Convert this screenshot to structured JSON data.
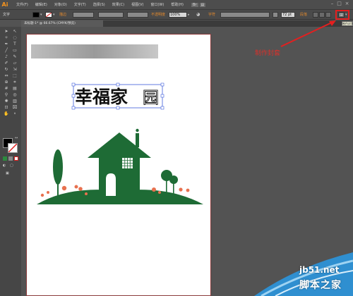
{
  "app": {
    "logo": "Ai"
  },
  "menu": [
    "文件(F)",
    "编辑(E)",
    "对象(O)",
    "文字(T)",
    "选择(S)",
    "效果(C)",
    "视图(V)",
    "窗口(W)",
    "帮助(H)"
  ],
  "controlbar": {
    "tool_label": "文字",
    "stroke_label": "描边",
    "opacity_label": "不透明度",
    "opacity_value": "100%",
    "char_label": "字符",
    "font_size": "72 pt",
    "paragraph_label": "段落"
  },
  "document": {
    "tab_label": "未标题-1* @ 66.67% (CMYK/预览)"
  },
  "artwork": {
    "title_bold": "幸福家",
    "title_outline": "园",
    "green": "#1e6b35",
    "flower_color": "#e8714f"
  },
  "annotation": {
    "label": "制作封套",
    "tooltip": "制作封套"
  },
  "watermark": {
    "site": "jb51.net",
    "name": "脚本之家"
  },
  "colors": {
    "highlight_red": "#e41f1f",
    "accent_orange": "#f7941d"
  }
}
